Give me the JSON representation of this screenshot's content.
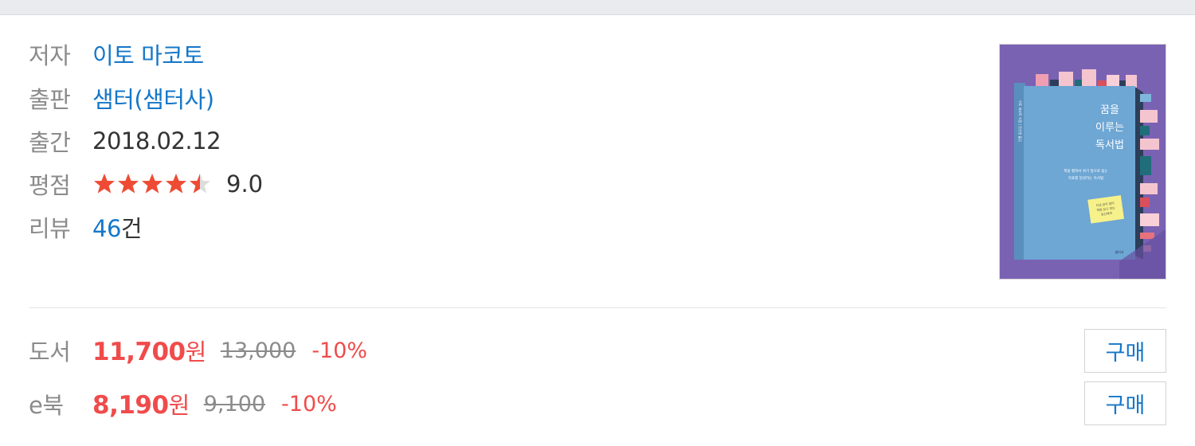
{
  "book": {
    "author_label": "저자",
    "author": "이토 마코토",
    "publisher_label": "출판",
    "publisher": "샘터(샘터사)",
    "pubdate_label": "출간",
    "pubdate": "2018.02.12",
    "rating_label": "평점",
    "rating_stars": 4.5,
    "rating_max": 5,
    "rating_score": "9.0",
    "review_label": "리뷰",
    "review_count": "46",
    "review_unit": "건",
    "cover": {
      "title_line1": "꿈을",
      "title_line2": "이루는",
      "title_line3": "독서법",
      "subtitle_line1": "책을 펼쳐서 위기 앞으로 돕는",
      "subtitle_line2": "목표를 달성하는 독서법",
      "note_line1": "지금 읽지 않아",
      "note_line2": "책을 읽고 있는",
      "note_line3": "당신에게",
      "publisher_mark": "샘터사",
      "spine_text": "이토 마코토 지음 | 전선영 옮김",
      "background_color": "#7a62b3",
      "book_color": "#6ea6d4"
    }
  },
  "prices": [
    {
      "label": "도서",
      "sale": "11,700",
      "unit": "원",
      "original": "13,000",
      "discount": "-10%",
      "button": "구매"
    },
    {
      "label": "e북",
      "sale": "8,190",
      "unit": "원",
      "original": "9,100",
      "discount": "-10%",
      "button": "구매"
    }
  ],
  "colors": {
    "link": "#1577c9",
    "sale": "#f04b4b",
    "star": "#ef4b34",
    "label": "#8b8b8b"
  }
}
